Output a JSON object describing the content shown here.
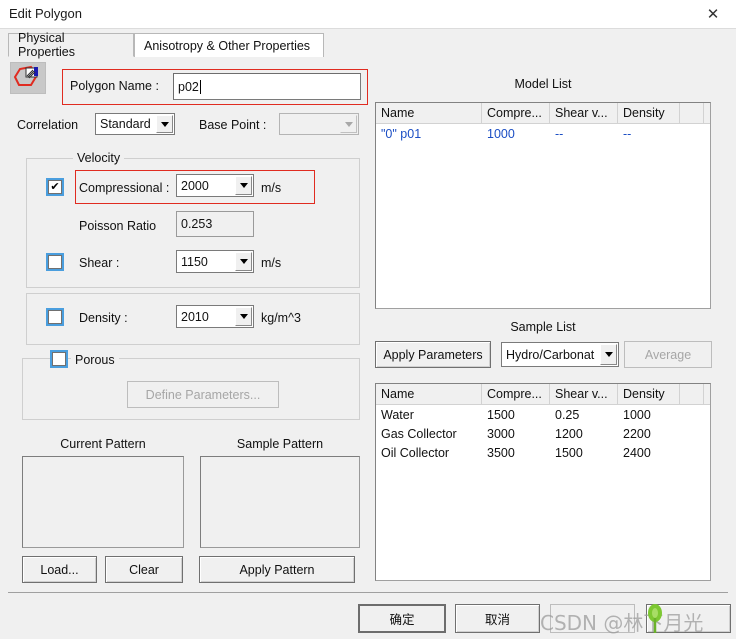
{
  "window": {
    "title": "Edit Polygon",
    "close_icon": "close-icon"
  },
  "tabs": [
    {
      "label": "Physical Properties",
      "active": true
    },
    {
      "label": "Anisotropy & Other Properties",
      "active": false
    }
  ],
  "form": {
    "polygon_icon": "polygon-edit-icon",
    "polygon_name_label": "Polygon Name :",
    "polygon_name_value": "p02",
    "correlation_label": "Correlation",
    "correlation_value": "Standard",
    "base_point_label": "Base Point :",
    "base_point_value": ""
  },
  "velocity": {
    "legend": "Velocity",
    "compressional_label": "Compressional :",
    "compressional_value": "2000",
    "compressional_unit": "m/s",
    "compressional_checked": true,
    "poisson_label": "Poisson Ratio",
    "poisson_value": "0.253",
    "shear_label": "Shear :",
    "shear_value": "1150",
    "shear_unit": "m/s",
    "shear_checked": false
  },
  "density": {
    "label": "Density :",
    "value": "2010",
    "unit": "kg/m^3",
    "checked": false
  },
  "porous": {
    "legend": "Porous",
    "checked": false,
    "define_button": "Define Parameters..."
  },
  "patterns": {
    "current_title": "Current Pattern",
    "sample_title": "Sample Pattern",
    "load_button": "Load...",
    "clear_button": "Clear",
    "apply_button": "Apply Pattern"
  },
  "model_list": {
    "title": "Model List",
    "columns": [
      "Name",
      "Compre...",
      "Shear v...",
      "Density",
      ""
    ],
    "rows": [
      {
        "selected": true,
        "cells": [
          "\"0\" p01",
          "1000",
          "--",
          "--",
          ""
        ]
      }
    ]
  },
  "sample_list": {
    "title": "Sample List",
    "apply_parameters_button": "Apply Parameters",
    "category_value": "Hydro/Carbonat",
    "average_button": "Average",
    "columns": [
      "Name",
      "Compre...",
      "Shear v...",
      "Density",
      ""
    ],
    "rows": [
      {
        "cells": [
          "Water",
          "1500",
          "0.25",
          "1000",
          ""
        ]
      },
      {
        "cells": [
          "Gas Collector",
          "3000",
          "1200",
          "2200",
          ""
        ]
      },
      {
        "cells": [
          "Oil Collector",
          "3500",
          "1500",
          "2400",
          ""
        ]
      }
    ]
  },
  "footer": {
    "ok_button": "确定",
    "cancel_button": "取消",
    "apply_button": ""
  },
  "watermark": {
    "text": "CSDN @林下月光"
  },
  "colors": {
    "highlight": "#e02b20",
    "accent": "#4a9ede",
    "selected_row": "#1b4ec4",
    "dialog_bg": "#f0f0f0"
  }
}
